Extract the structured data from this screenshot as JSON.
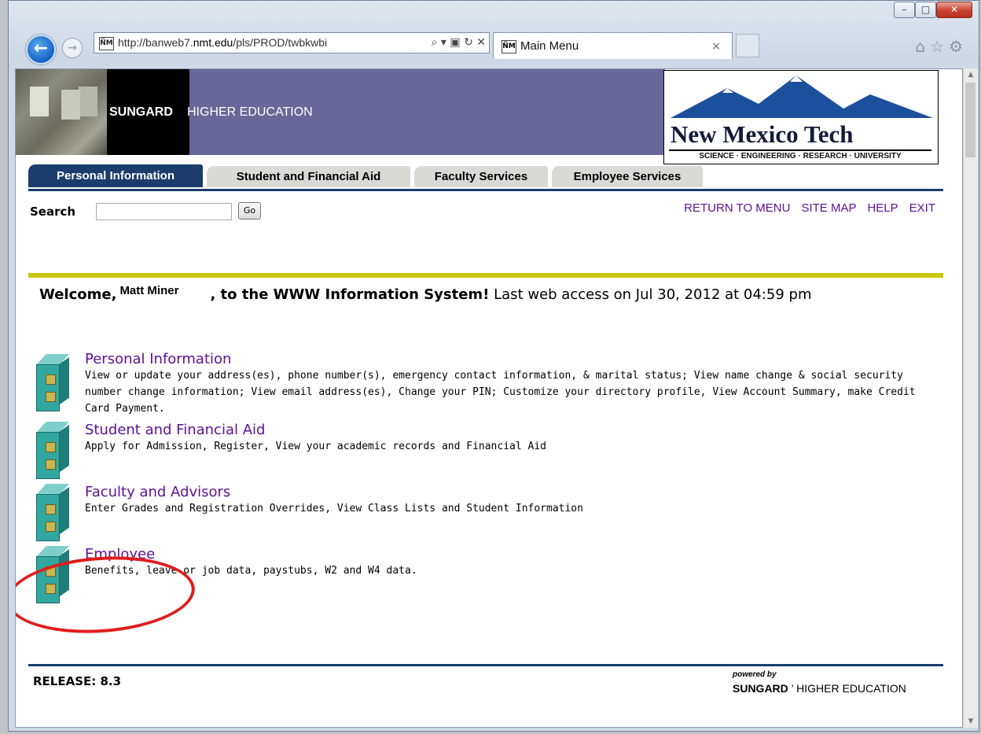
{
  "browser": {
    "url_prefix": "http://banweb7.",
    "url_domain": "nmt.edu",
    "url_suffix": "/pls/PROD/twbkwbi",
    "address_controls": "⌕ ▾ ▣ ↻ ✕",
    "favicon": "N̅M",
    "tab_title": "Main Menu",
    "tab_close": "×",
    "toolbar_icons": [
      "home-icon",
      "star-icon",
      "gear-icon"
    ]
  },
  "banner": {
    "brand_bold": "SUNGARD",
    "brand_light": "HIGHER EDUCATION",
    "school_name": "New Mexico Tech",
    "school_tagline": "SCIENCE · ENGINEERING · RESEARCH · UNIVERSITY"
  },
  "tabs": [
    {
      "label": "Personal Information",
      "active": true
    },
    {
      "label": "Student and Financial Aid",
      "active": false
    },
    {
      "label": "Faculty Services",
      "active": false
    },
    {
      "label": "Employee Services",
      "active": false
    }
  ],
  "search": {
    "label": "Search",
    "value": "",
    "button": "Go"
  },
  "toplinks": [
    "RETURN TO MENU",
    "SITE MAP",
    "HELP",
    "EXIT"
  ],
  "welcome": {
    "prefix": "Welcome,",
    "user": "Matt Miner",
    "middle": ", to the WWW Information System!",
    "tail": " Last web access on Jul 30, 2012 at 04:59 pm"
  },
  "menu": [
    {
      "title": "Personal Information",
      "desc": "View or update your address(es), phone number(s), emergency contact information, & marital status; View name change & social security number change information; View email address(es), Change your PIN; Customize your directory profile, View Account Summary, make Credit Card Payment."
    },
    {
      "title": "Student and Financial Aid",
      "desc": "Apply for Admission, Register, View your academic records and Financial Aid"
    },
    {
      "title": "Faculty and Advisors",
      "desc": "Enter Grades and Registration Overrides, View Class Lists and Student Information"
    },
    {
      "title": "Employee",
      "desc": "Benefits, leave or job data, paystubs, W2 and W4 data."
    }
  ],
  "footer": {
    "release": "RELEASE: 8.3",
    "powered_by": "powered by",
    "powered_bold": "SUNGARD",
    "powered_light": "HIGHER EDUCATION"
  },
  "colors": {
    "nav_blue": "#1a3d6d",
    "link_purple": "#5c1196",
    "accent_yellow": "#c9c708",
    "highlight_red": "#e01d1d"
  }
}
